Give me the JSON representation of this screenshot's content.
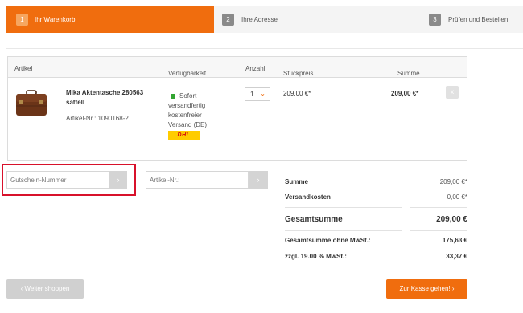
{
  "steps": [
    {
      "number": "1",
      "label": "Ihr Warenkorb"
    },
    {
      "number": "2",
      "label": "Ihre Adresse"
    },
    {
      "number": "3",
      "label": "Prüfen und Bestellen"
    }
  ],
  "colors": {
    "accent": "#f06d0e",
    "highlight": "#d8112b",
    "available": "#33a532"
  },
  "table": {
    "headers": {
      "article": "Artikel",
      "availability": "Verfügbarkeit",
      "quantity": "Anzahl",
      "unit_price": "Stückpreis",
      "total": "Summe"
    }
  },
  "item": {
    "name": "Mika Aktentasche 280563 sattell",
    "number": "Artikel-Nr.: 1090168-2",
    "availability_line1": "Sofort",
    "availability_line2": "versandfertig",
    "availability_line3": "kostenfreier",
    "availability_line4": "Versand (DE)",
    "carrier_logo": "DHL",
    "quantity": "1",
    "unit_price": "209,00 €*",
    "total": "209,00 €*",
    "remove_icon": "x"
  },
  "voucher": {
    "placeholder": "Gutschein-Nummer",
    "submit_icon": "›"
  },
  "article_add": {
    "placeholder": "Artikel-Nr.:",
    "submit_icon": "›"
  },
  "summary": {
    "subtotal_label": "Summe",
    "subtotal": "209,00 €*",
    "shipping_label": "Versandkosten",
    "shipping": "0,00 €*",
    "grand_total_label": "Gesamtsumme",
    "grand_total": "209,00 €",
    "net_label": "Gesamtsumme ohne MwSt.:",
    "net": "175,63 €",
    "vat_label": "zzgl. 19.00 % MwSt.:",
    "vat": "33,37 €"
  },
  "buttons": {
    "continue_label": "‹  Weiter shoppen",
    "checkout_label": "Zur Kasse gehen!  ›"
  }
}
